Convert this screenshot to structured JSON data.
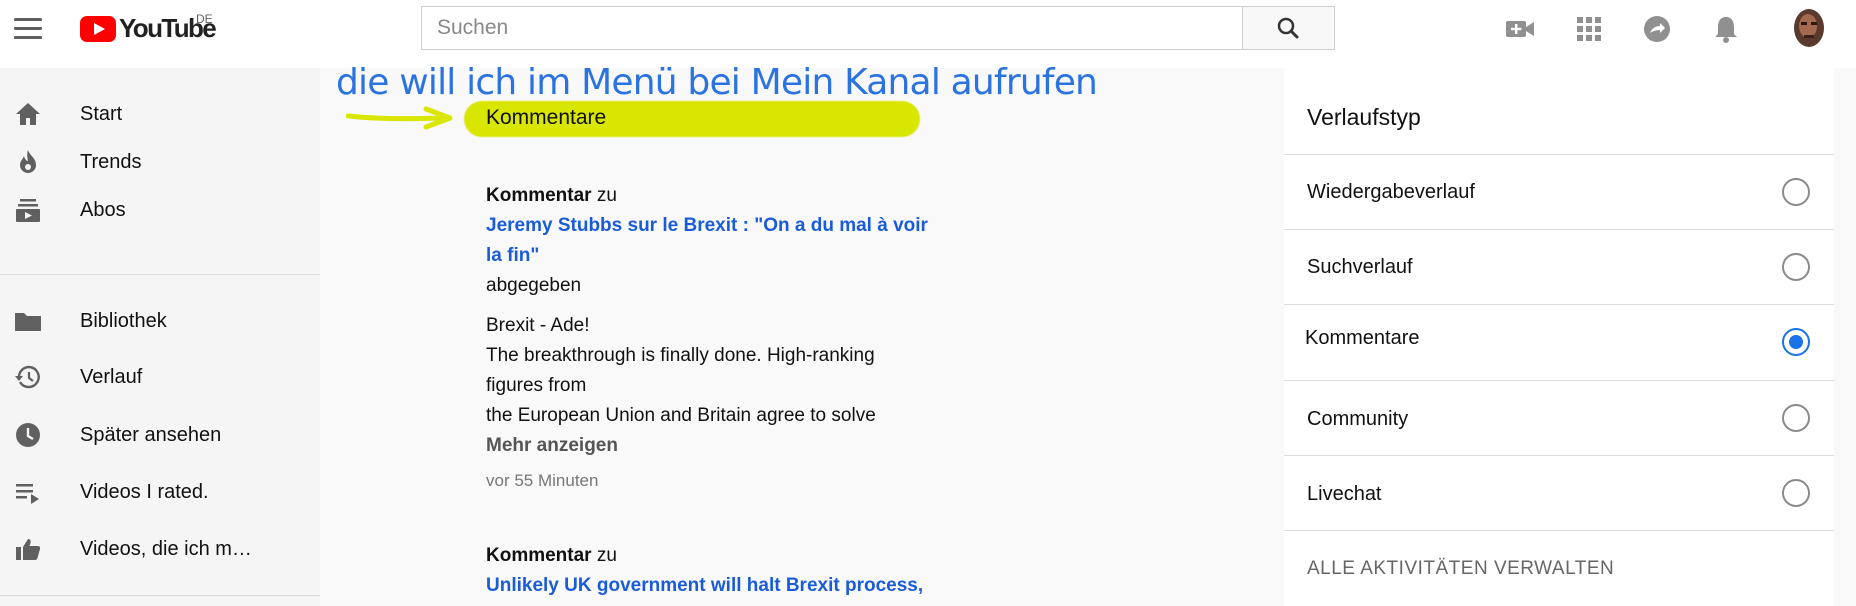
{
  "header": {
    "logo_text": "YouTube",
    "country_code": "DE",
    "search_placeholder": "Suchen"
  },
  "sidebar": {
    "items": [
      {
        "label": "Start",
        "icon": "home-icon"
      },
      {
        "label": "Trends",
        "icon": "flame-icon"
      },
      {
        "label": "Abos",
        "icon": "subscriptions-icon"
      },
      {
        "label": "Bibliothek",
        "icon": "folder-icon"
      },
      {
        "label": "Verlauf",
        "icon": "history-icon"
      },
      {
        "label": "Später ansehen",
        "icon": "clock-icon"
      },
      {
        "label": "Videos I rated.",
        "icon": "playlist-icon"
      },
      {
        "label": "Videos, die ich m…",
        "icon": "thumbs-up-icon"
      }
    ]
  },
  "annotation": {
    "text": "die will ich im Menü bei Mein Kanal aufrufen",
    "color": "#2b73e0",
    "highlight_color": "#d8e600"
  },
  "main": {
    "section_title": "Kommentare",
    "comments": [
      {
        "prefix": "Kommentar",
        "connector": "zu",
        "video_title_line1": "Jeremy Stubbs sur le Brexit : \"On a du mal à voir",
        "video_title_line2": "la fin\"",
        "suffix": "abgegeben",
        "body_line1": "Brexit - Ade!",
        "body_line2": "The breakthrough is finally done. High-ranking",
        "body_line3": "figures from",
        "body_line4": "the European Union and Britain agree to solve",
        "more": "Mehr anzeigen",
        "time": "vor 55 Minuten"
      },
      {
        "prefix": "Kommentar",
        "connector": "zu",
        "video_title_line1": "Unlikely UK government will halt Brexit process,"
      }
    ]
  },
  "right_panel": {
    "title": "Verlaufstyp",
    "options": [
      {
        "label": "Wiedergabeverlauf",
        "selected": false
      },
      {
        "label": "Suchverlauf",
        "selected": false
      },
      {
        "label": "Kommentare",
        "selected": true
      },
      {
        "label": "Community",
        "selected": false
      },
      {
        "label": "Livechat",
        "selected": false
      }
    ],
    "manage": "ALLE AKTIVITÄTEN VERWALTEN",
    "accent_color": "#1a73e8"
  }
}
